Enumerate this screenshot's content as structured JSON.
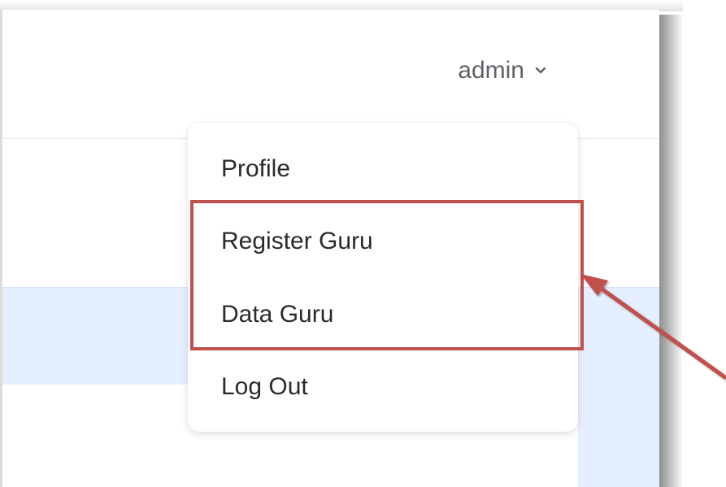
{
  "header": {
    "user_label": "admin",
    "chevron_icon": "chevron-down-icon"
  },
  "dropdown": {
    "items": [
      {
        "label": "Profile"
      },
      {
        "label": "Register Guru"
      },
      {
        "label": "Data Guru"
      },
      {
        "label": "Log Out"
      }
    ]
  },
  "annotation": {
    "highlight_color": "#c0504d",
    "arrow_color": "#c0504d"
  },
  "colors": {
    "row_highlight": "#e4efff",
    "text_muted": "#5f6368",
    "text": "#2b2b2b"
  }
}
